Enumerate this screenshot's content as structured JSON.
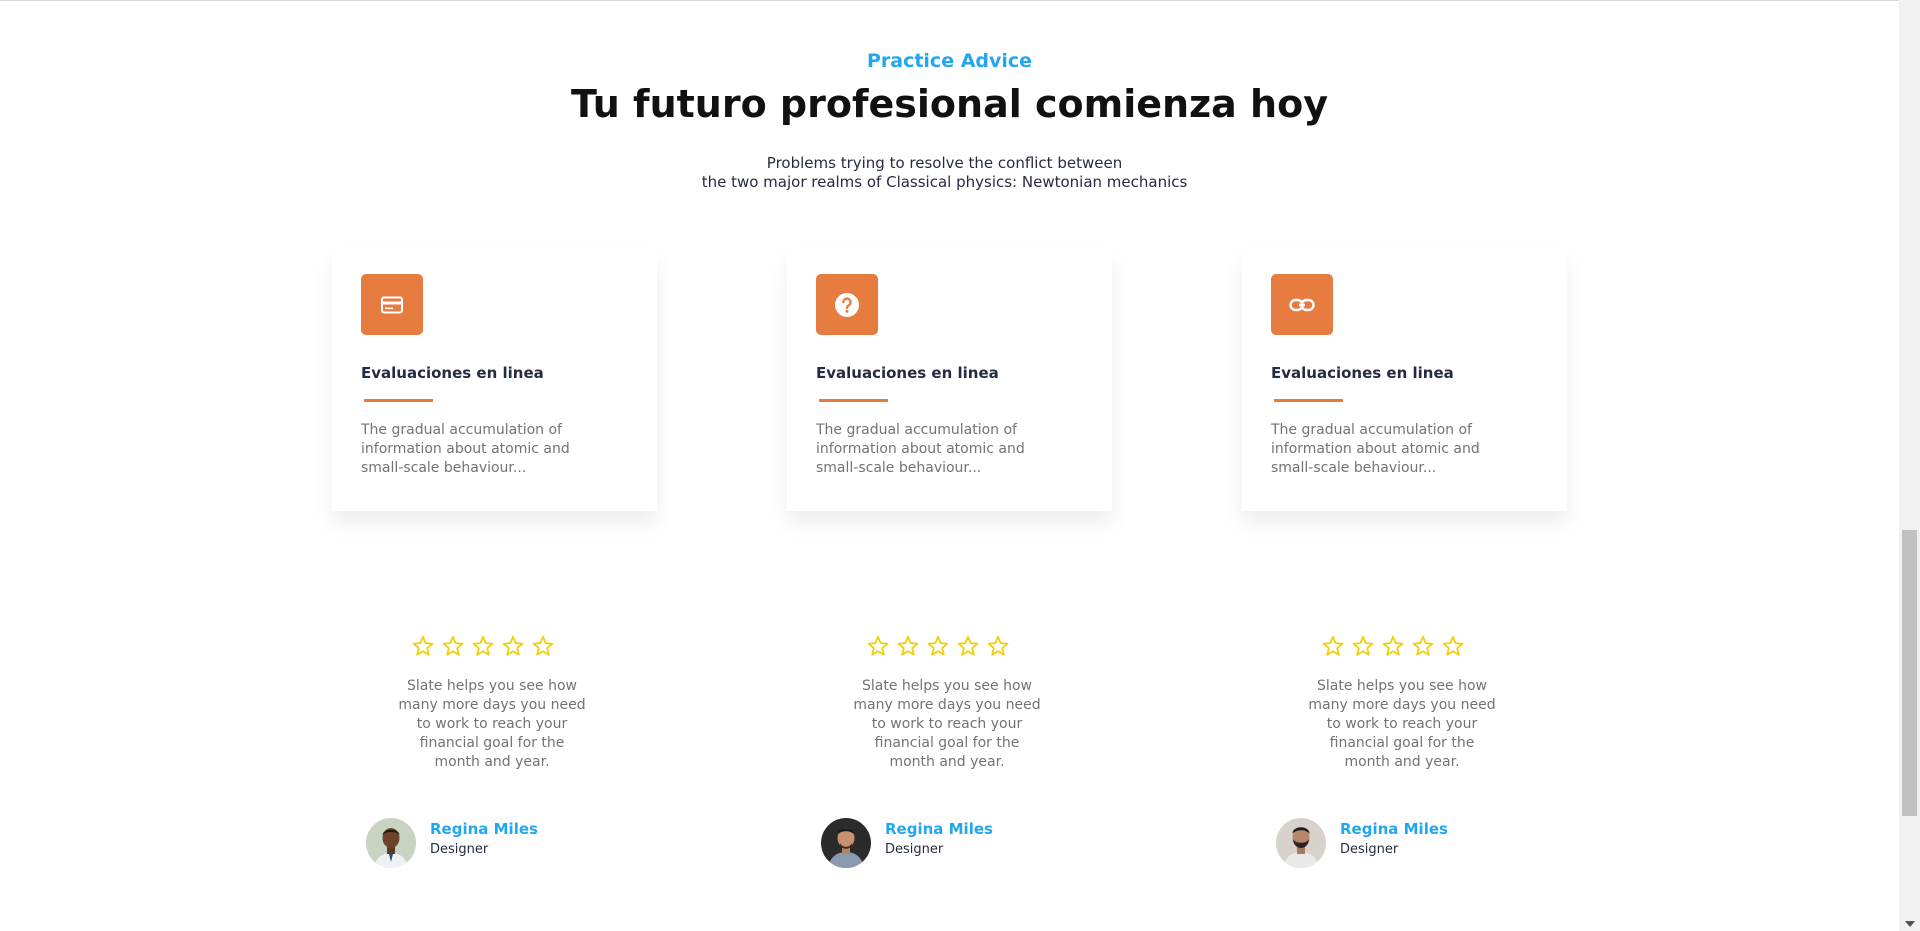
{
  "header": {
    "eyebrow": "Practice Advice",
    "title": "Tu futuro profesional comienza hoy",
    "subtitle_line1": "Problems trying to resolve the conflict between",
    "subtitle_line2": "the two major realms of Classical physics: Newtonian mechanics"
  },
  "colors": {
    "accent_orange": "#E77C40",
    "accent_blue": "#23A6F0",
    "star_yellow": "#F3CD03",
    "text_dark": "#252B42",
    "text_muted": "#737373"
  },
  "cards": [
    {
      "icon": "credit-card-icon",
      "title": "Evaluaciones en linea",
      "text": "The gradual accumulation of information about atomic and small-scale behaviour..."
    },
    {
      "icon": "question-circle-icon",
      "title": "Evaluaciones en linea",
      "text": "The gradual accumulation of information about atomic and small-scale behaviour..."
    },
    {
      "icon": "link-icon",
      "title": "Evaluaciones en linea",
      "text": "The gradual accumulation of information about atomic and small-scale behaviour..."
    }
  ],
  "testimonials": [
    {
      "rating": 5,
      "quote": "Slate helps you see how many more days you need to work to reach your financial goal for the month and year.",
      "name": "Regina Miles",
      "role": "Designer",
      "avatar": "avatar-photo"
    },
    {
      "rating": 5,
      "quote": "Slate helps you see how many more days you need to work to reach your financial goal for the month and year.",
      "name": "Regina Miles",
      "role": "Designer",
      "avatar": "avatar-photo"
    },
    {
      "rating": 5,
      "quote": "Slate helps you see how many more days you need to work to reach your financial goal for the month and year.",
      "name": "Regina Miles",
      "role": "Designer",
      "avatar": "avatar-photo"
    }
  ]
}
